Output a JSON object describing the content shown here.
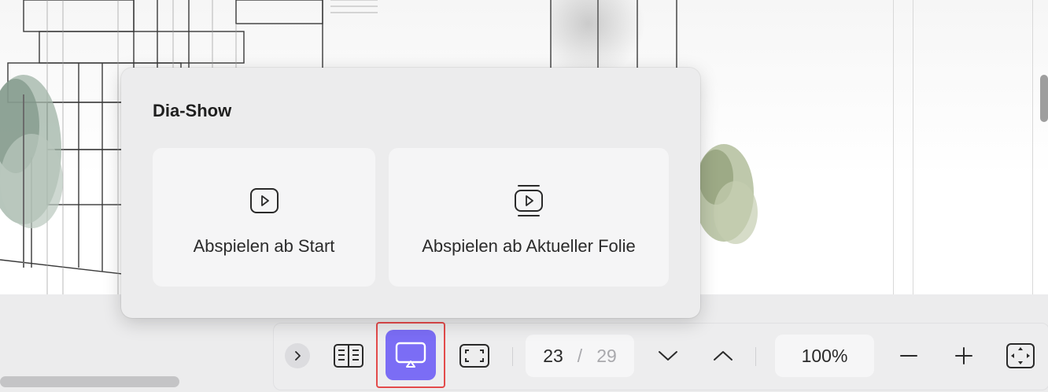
{
  "popover": {
    "title": "Dia-Show",
    "options": [
      {
        "label": "Abspielen ab Start",
        "icon": "play-icon"
      },
      {
        "label": "Abspielen ab Aktueller Folie",
        "icon": "play-current-slide-icon"
      }
    ]
  },
  "toolbar": {
    "current_page": "23",
    "separator": "/",
    "total_pages": "29",
    "zoom": "100%",
    "icons": [
      "chevron-right-icon",
      "book-view-icon",
      "present-icon",
      "fullscreen-icon",
      "chevron-down-icon",
      "chevron-up-icon",
      "minus-icon",
      "plus-icon",
      "fit-to-window-icon"
    ],
    "present_active_color": "#7b6df5",
    "highlight_color": "#e34b4b"
  }
}
